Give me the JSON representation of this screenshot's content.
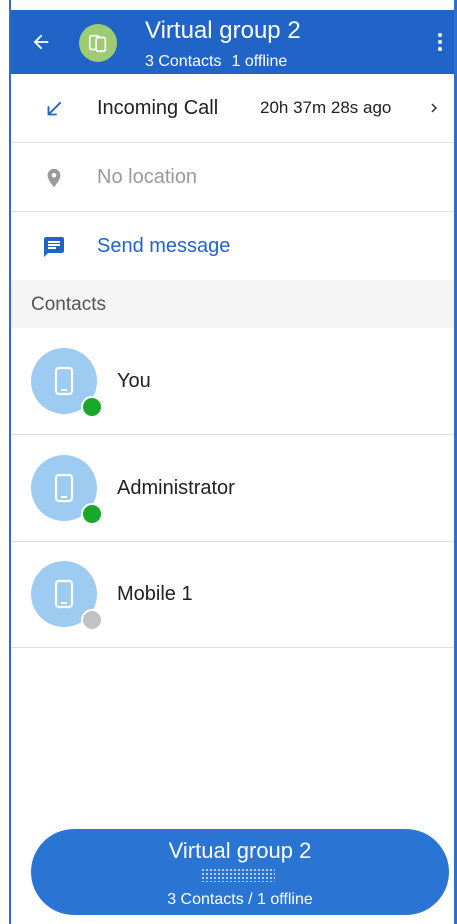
{
  "header": {
    "title": "Virtual group 2",
    "contacts_count": "3 Contacts",
    "offline_count": "1 offline"
  },
  "call": {
    "label": "Incoming Call",
    "time_ago": "20h 37m 28s ago"
  },
  "location": {
    "label": "No location"
  },
  "message": {
    "label": "Send message"
  },
  "contacts": {
    "section_title": "Contacts",
    "items": [
      {
        "name": "You",
        "status": "online"
      },
      {
        "name": "Administrator",
        "status": "online"
      },
      {
        "name": "Mobile 1",
        "status": "offline"
      }
    ]
  },
  "bottom_bar": {
    "title": "Virtual group 2",
    "summary": "3 Contacts / 1 offline"
  },
  "colors": {
    "primary": "#2064c8",
    "online": "#1aa82a",
    "offline": "#c2c2c2",
    "avatar_group": "#9ccb74",
    "avatar_contact": "#9ecbf2"
  },
  "icons": {
    "back": "arrow-left-icon",
    "group": "phones-icon",
    "more": "more-vert-icon",
    "call": "incoming-call-arrow-icon",
    "location": "location-pin-icon",
    "message": "message-icon",
    "contact": "phone-icon"
  }
}
